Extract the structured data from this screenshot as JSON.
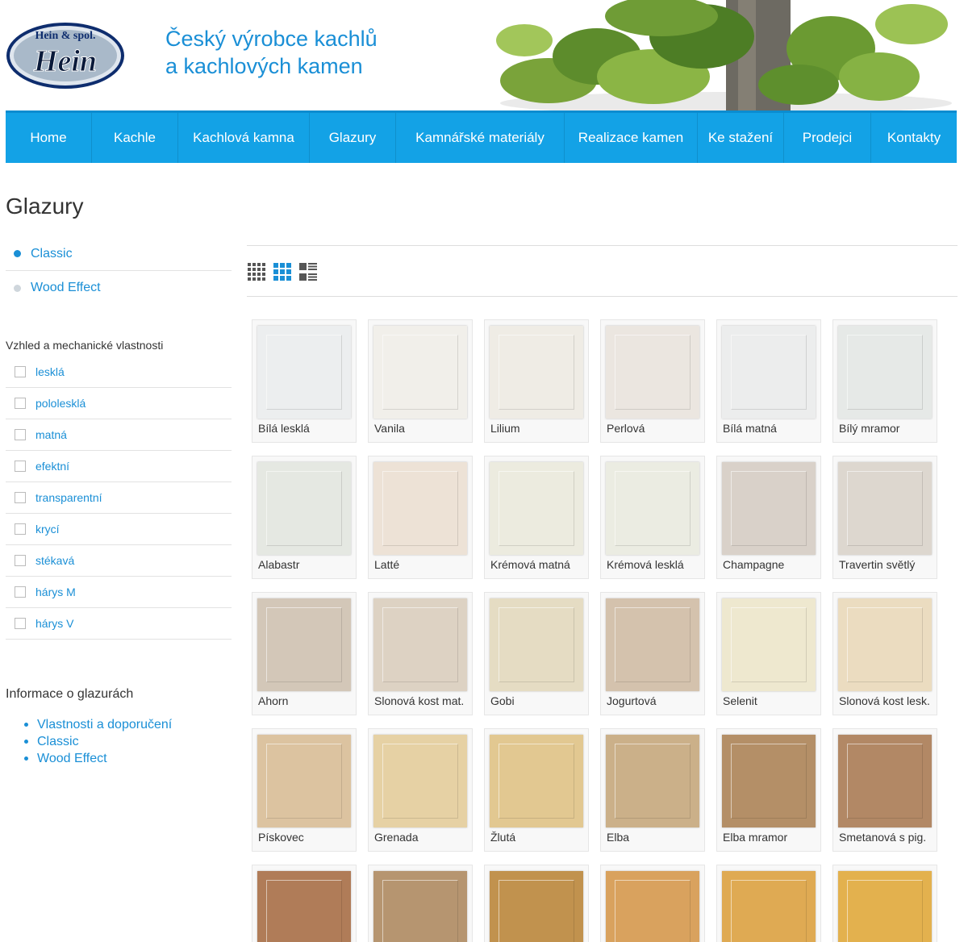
{
  "header": {
    "logo_top": "Hein & spol.",
    "logo_main": "Hein",
    "tagline_line1": "Český výrobce kachlů",
    "tagline_line2": "a kachlových kamen"
  },
  "nav": {
    "items": [
      {
        "label": "Home"
      },
      {
        "label": "Kachle"
      },
      {
        "label": "Kachlová kamna"
      },
      {
        "label": "Glazury"
      },
      {
        "label": "Kamnářské materiály"
      },
      {
        "label": "Realizace kamen"
      },
      {
        "label": "Ke stažení"
      },
      {
        "label": "Prodejci"
      },
      {
        "label": "Kontakty"
      }
    ]
  },
  "page": {
    "title": "Glazury"
  },
  "categories": [
    {
      "label": "Classic",
      "active": true
    },
    {
      "label": "Wood Effect",
      "active": false
    }
  ],
  "filters": {
    "heading": "Vzhled a mechanické vlastnosti",
    "items": [
      {
        "label": "lesklá"
      },
      {
        "label": "pololesklá"
      },
      {
        "label": "matná"
      },
      {
        "label": "efektní"
      },
      {
        "label": "transparentní"
      },
      {
        "label": "krycí"
      },
      {
        "label": "stékavá"
      },
      {
        "label": "hárys M"
      },
      {
        "label": "hárys V"
      }
    ]
  },
  "info": {
    "heading": "Informace o glazurách",
    "links": [
      {
        "label": "Vlastnosti a doporučení"
      },
      {
        "label": "Classic"
      },
      {
        "label": "Wood Effect"
      }
    ]
  },
  "view_modes": [
    "small-grid-icon",
    "medium-grid-icon",
    "list-view-icon"
  ],
  "active_view": "medium-grid-icon",
  "colors": {
    "accent": "#1a8fd6",
    "nav": "#13a2e6",
    "dot_active": "#1a8fd6",
    "dot_inactive": "#cfd6dc"
  },
  "glazes": [
    {
      "name": "Bílá lesklá",
      "color": "#eceeef"
    },
    {
      "name": "Vanila",
      "color": "#f1efea"
    },
    {
      "name": "Lilium",
      "color": "#efece5"
    },
    {
      "name": "Perlová",
      "color": "#ebe6e0"
    },
    {
      "name": "Bílá matná",
      "color": "#eceded"
    },
    {
      "name": "Bílý mramor",
      "color": "#e6e9e7"
    },
    {
      "name": "Alabastr",
      "color": "#e5e8e2"
    },
    {
      "name": "Latté",
      "color": "#ede2d6"
    },
    {
      "name": "Krémová matná",
      "color": "#ecebdf"
    },
    {
      "name": "Krémová lesklá",
      "color": "#ebece2"
    },
    {
      "name": "Champagne",
      "color": "#d9d1c9"
    },
    {
      "name": "Travertin světlý",
      "color": "#ddd7cf"
    },
    {
      "name": "Ahorn",
      "color": "#d3c7b8"
    },
    {
      "name": "Slonová kost mat.",
      "color": "#ddd2c3"
    },
    {
      "name": "Gobi",
      "color": "#e5dcc3"
    },
    {
      "name": "Jogurtová",
      "color": "#d4c2ad"
    },
    {
      "name": "Selenit",
      "color": "#eee8cf"
    },
    {
      "name": "Slonová kost lesk.",
      "color": "#ebdcc0"
    },
    {
      "name": "Pískovec",
      "color": "#dcc3a0"
    },
    {
      "name": "Grenada",
      "color": "#e6d1a4"
    },
    {
      "name": "Žlutá",
      "color": "#e2c891"
    },
    {
      "name": "Elba",
      "color": "#cbb089"
    },
    {
      "name": "Elba mramor",
      "color": "#b48f67"
    },
    {
      "name": "Smetanová s pig.",
      "color": "#b28865"
    },
    {
      "name": "",
      "color": "#b07c58"
    },
    {
      "name": "",
      "color": "#b69570"
    },
    {
      "name": "",
      "color": "#c1924e"
    },
    {
      "name": "",
      "color": "#d9a25e"
    },
    {
      "name": "",
      "color": "#dfaa53"
    },
    {
      "name": "",
      "color": "#e3b14e"
    }
  ]
}
